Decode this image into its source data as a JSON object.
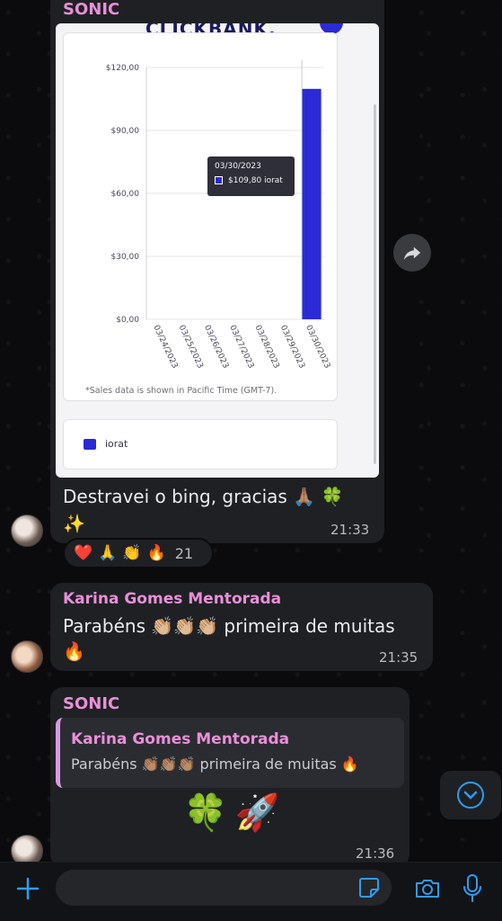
{
  "colors": {
    "bubble": "#1f2024",
    "sender_sonic": "#e98fd8",
    "sender_karina": "#e98fd8",
    "accent": "#2f9cf0",
    "chart_bar": "#2b2ad6"
  },
  "messages": {
    "sonic_1": {
      "sender": "SONIC",
      "text_line1": "Destravei o bing, gracias 🙏🏽 🍀",
      "text_line2": "✨",
      "time": "21:33",
      "card": {
        "logo": "CLICKBANK.",
        "tooltip_date": "03/30/2023",
        "tooltip_value": "$109,80 iorat",
        "footnote": "*Sales data is shown in Pacific Time (GMT-7).",
        "legend_label": "iorat"
      },
      "reactions": [
        "❤️",
        "🙏",
        "👏",
        "🔥"
      ],
      "reaction_count": "21"
    },
    "karina": {
      "sender": "Karina Gomes Mentorada",
      "text_line1": "Parabéns 👏🏼👏🏼👏🏼 primeira de muitas",
      "text_line2": "🔥",
      "time": "21:35"
    },
    "sonic_2": {
      "sender": "SONIC",
      "quote_sender": "Karina Gomes Mentorada",
      "quote_text": "Parabéns 👏🏽👏🏽👏🏽 primeira de muitas 🔥",
      "text": "🍀🚀",
      "time": "21:36"
    }
  },
  "icons": {
    "forward": "forward-icon",
    "scroll_down": "chevron-down-icon",
    "attach": "plus-icon",
    "sticker": "sticker-icon",
    "camera": "camera-icon",
    "mic": "microphone-icon"
  },
  "chart_data": {
    "type": "bar",
    "categories": [
      "03/24/2023",
      "03/25/2023",
      "03/26/2023",
      "03/27/2023",
      "03/28/2023",
      "03/29/2023",
      "03/30/2023"
    ],
    "series": [
      {
        "name": "iorat",
        "values": [
          0,
          0,
          0,
          0,
          0,
          0,
          109.8
        ]
      }
    ],
    "yticks": [
      "$0,00",
      "$30,00",
      "$60,00",
      "$90,00",
      "$120,00"
    ],
    "ylim": [
      0,
      120
    ],
    "grid": true,
    "legend": "bottom"
  }
}
